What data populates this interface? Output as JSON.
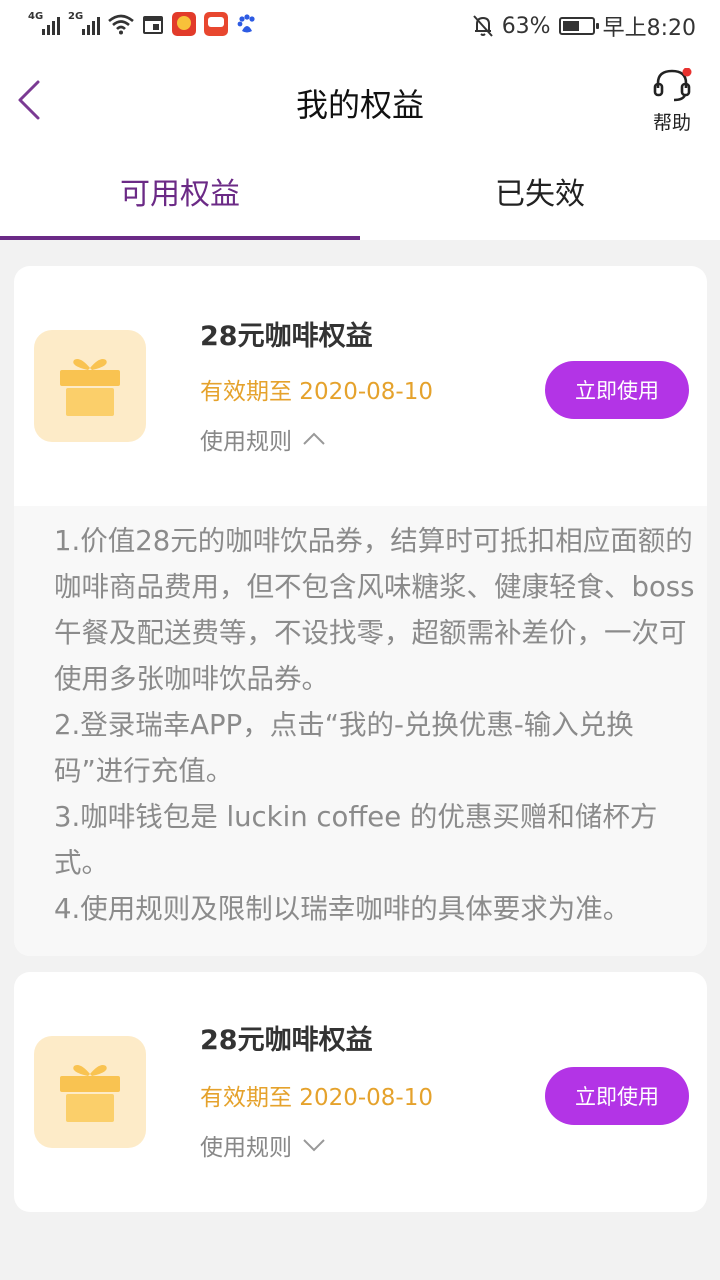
{
  "status_bar": {
    "net1": "4G",
    "net2": "2G",
    "battery_text": "63%",
    "battery_level": 0.63,
    "time": "早上8:20"
  },
  "header": {
    "title": "我的权益",
    "help_label": "帮助"
  },
  "tabs": [
    {
      "label": "可用权益",
      "active": true
    },
    {
      "label": "已失效",
      "active": false
    }
  ],
  "cards": [
    {
      "title": "28元咖啡权益",
      "expiry": "有效期至 2020-08-10",
      "rules_label": "使用规则",
      "rules_expanded": true,
      "button": "立即使用",
      "rules": [
        "1.价值28元的咖啡饮品券，结算时可抵扣相应面额的咖啡商品费用，但不包含风味糖浆、健康轻食、boss午餐及配送费等，不设找零，超额需补差价，一次可使用多张咖啡饮品券。",
        "2.登录瑞幸APP，点击“我的-兑换优惠-输入兑换码”进行充值。",
        "3.咖啡钱包是 luckin coffee 的优惠买赠和储杯方式。",
        "4.使用规则及限制以瑞幸咖啡的具体要求为准。"
      ]
    },
    {
      "title": "28元咖啡权益",
      "expiry": "有效期至 2020-08-10",
      "rules_label": "使用规则",
      "rules_expanded": false,
      "button": "立即使用"
    }
  ],
  "colors": {
    "accent": "#6b2a86",
    "button": "#b334e6",
    "expiry": "#e5a22c",
    "gift_bg": "#fdebc8",
    "gift": "#f9c351"
  }
}
